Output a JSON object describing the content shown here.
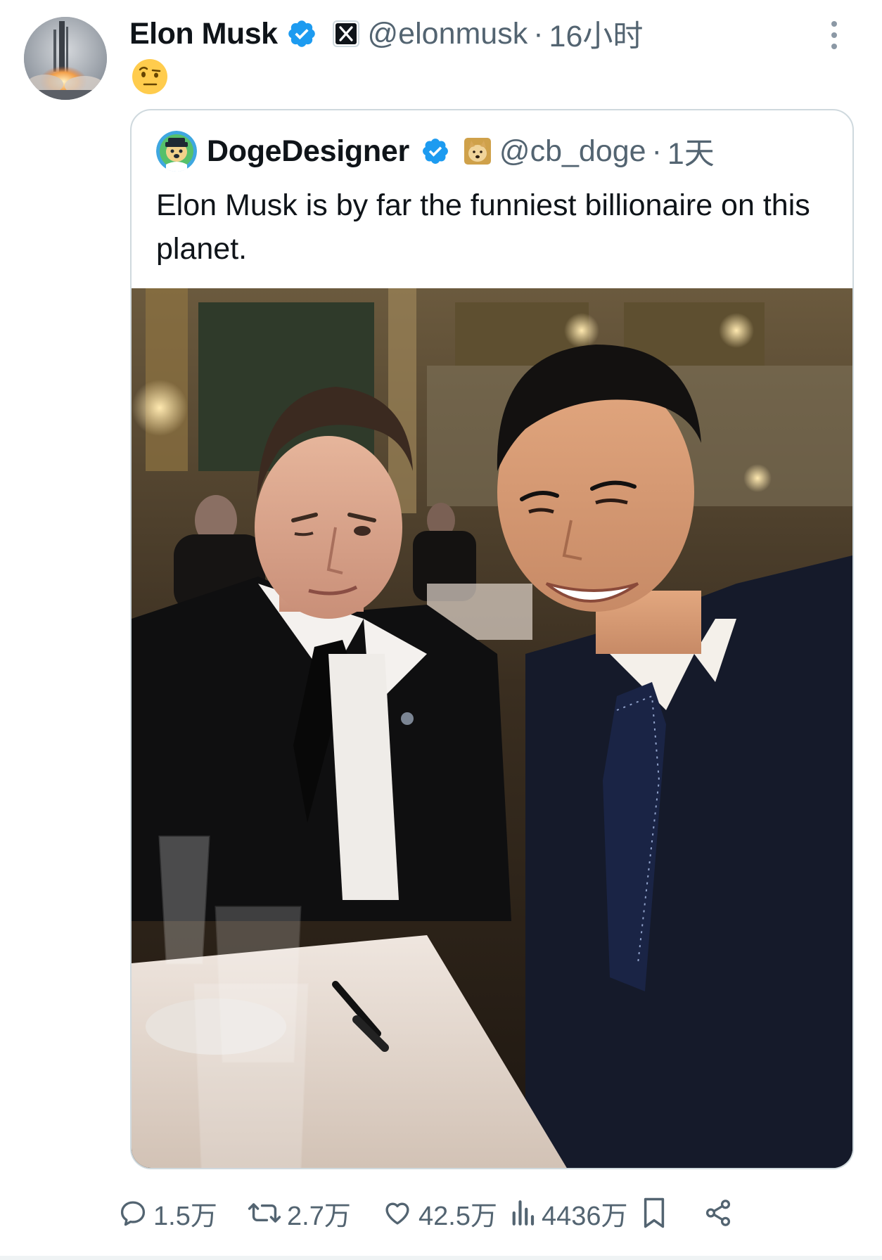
{
  "author": {
    "display_name": "Elon Musk",
    "handle": "@elonmusk",
    "separator": "·",
    "time": "16小时",
    "avatar_icon": "rocket-launch-avatar",
    "verified_color": "#1d9bf0"
  },
  "tweet": {
    "emoji_icon": "face-with-raised-eyebrow-emoji"
  },
  "quoted": {
    "display_name": "DogeDesigner",
    "handle": "@cb_doge",
    "separator": "·",
    "time": "1天",
    "avatar_icon": "doge-cartoon-avatar",
    "badge_icon": "doge-badge-icon",
    "text": "Elon Musk is by far the funniest billionaire on this planet.",
    "photo_icon": "two-men-selfie-photo"
  },
  "actions": {
    "reply_count": "1.5万",
    "retweet_count": "2.7万",
    "like_count": "42.5万",
    "views_count": "4436万"
  },
  "colors": {
    "text_primary": "#0f1419",
    "text_secondary": "#536471",
    "border": "#cfd9de",
    "verified": "#1d9bf0"
  }
}
